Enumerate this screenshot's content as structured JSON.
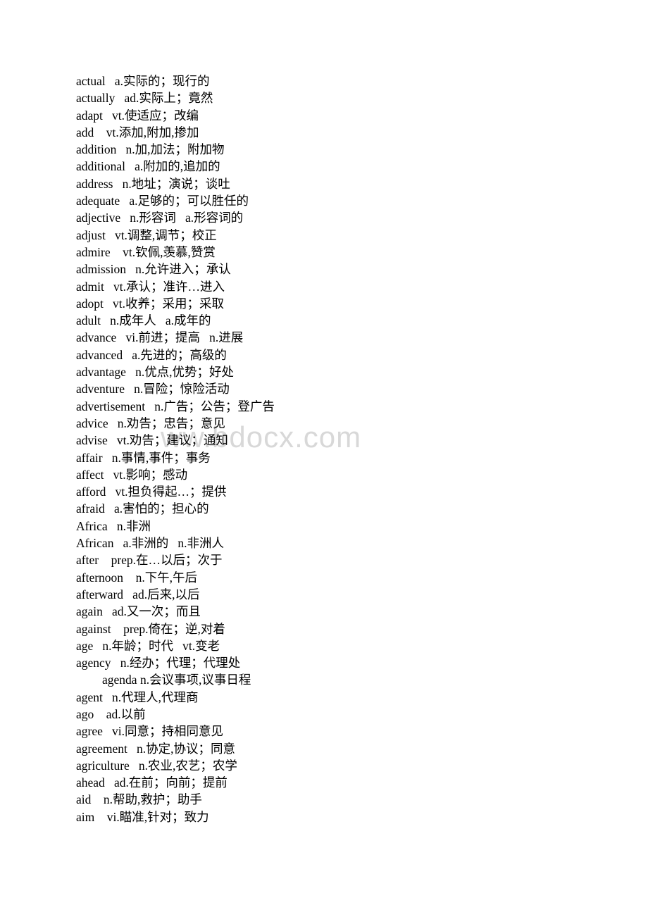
{
  "watermark": {
    "text": "ww.bdocx.com"
  },
  "document": {
    "entries": [
      {
        "word": "actual",
        "gap": "   ",
        "def": "a.实际的；现行的",
        "indent": false
      },
      {
        "word": "actually",
        "gap": "   ",
        "def": "ad.实际上；竟然",
        "indent": false
      },
      {
        "word": "adapt",
        "gap": "   ",
        "def": "vt.使适应；改编",
        "indent": false
      },
      {
        "word": "add",
        "gap": "    ",
        "def": "vt.添加,附加,掺加",
        "indent": false
      },
      {
        "word": "addition",
        "gap": "   ",
        "def": "n.加,加法；附加物",
        "indent": false
      },
      {
        "word": "additional",
        "gap": "   ",
        "def": "a.附加的,追加的",
        "indent": false
      },
      {
        "word": "address",
        "gap": "   ",
        "def": "n.地址；演说；谈吐",
        "indent": false
      },
      {
        "word": "adequate",
        "gap": "   ",
        "def": "a.足够的；可以胜任的",
        "indent": false
      },
      {
        "word": "adjective",
        "gap": "   ",
        "def": "n.形容词   a.形容词的",
        "indent": false
      },
      {
        "word": "adjust",
        "gap": "   ",
        "def": "vt.调整,调节；校正",
        "indent": false
      },
      {
        "word": "admire",
        "gap": "    ",
        "def": "vt.钦佩,羡慕,赞赏",
        "indent": false
      },
      {
        "word": "admission",
        "gap": "   ",
        "def": "n.允许进入；承认",
        "indent": false
      },
      {
        "word": "admit",
        "gap": "   ",
        "def": "vt.承认；准许…进入",
        "indent": false
      },
      {
        "word": "adopt",
        "gap": "   ",
        "def": "vt.收养；采用；采取",
        "indent": false
      },
      {
        "word": "adult",
        "gap": "   ",
        "def": "n.成年人   a.成年的",
        "indent": false
      },
      {
        "word": "advance",
        "gap": "   ",
        "def": "vi.前进；提高   n.进展",
        "indent": false
      },
      {
        "word": "advanced",
        "gap": "   ",
        "def": "a.先进的；高级的",
        "indent": false
      },
      {
        "word": "advantage",
        "gap": "   ",
        "def": "n.优点,优势；好处",
        "indent": false
      },
      {
        "word": "adventure",
        "gap": "   ",
        "def": "n.冒险；惊险活动",
        "indent": false
      },
      {
        "word": "advertisement",
        "gap": "   ",
        "def": "n.广告；公告；登广告",
        "indent": false
      },
      {
        "word": "advice",
        "gap": "   ",
        "def": "n.劝告；忠告；意见",
        "indent": false
      },
      {
        "word": "advise",
        "gap": "   ",
        "def": "vt.劝告；建议；通知",
        "indent": false
      },
      {
        "word": "affair",
        "gap": "   ",
        "def": "n.事情,事件；事务",
        "indent": false
      },
      {
        "word": "affect",
        "gap": "   ",
        "def": "vt.影响；感动",
        "indent": false
      },
      {
        "word": "afford",
        "gap": "   ",
        "def": "vt.担负得起…；提供",
        "indent": false
      },
      {
        "word": "afraid",
        "gap": "   ",
        "def": "a.害怕的；担心的",
        "indent": false
      },
      {
        "word": "Africa",
        "gap": "   ",
        "def": "n.非洲",
        "indent": false
      },
      {
        "word": "African",
        "gap": "   ",
        "def": "a.非洲的   n.非洲人",
        "indent": false
      },
      {
        "word": "after",
        "gap": "    ",
        "def": "prep.在…以后；次于",
        "indent": false
      },
      {
        "word": "afternoon",
        "gap": "    ",
        "def": "n.下午,午后",
        "indent": false
      },
      {
        "word": "afterward",
        "gap": "   ",
        "def": "ad.后来,以后",
        "indent": false
      },
      {
        "word": "again",
        "gap": "   ",
        "def": "ad.又一次；而且",
        "indent": false
      },
      {
        "word": "against",
        "gap": "    ",
        "def": "prep.倚在；逆,对着",
        "indent": false
      },
      {
        "word": "age",
        "gap": "   ",
        "def": "n.年龄；时代   vt.变老",
        "indent": false
      },
      {
        "word": "agency",
        "gap": "   ",
        "def": "n.经办；代理；代理处",
        "indent": false
      },
      {
        "word": "agenda",
        "gap": " ",
        "def": "n.会议事项,议事日程",
        "indent": true
      },
      {
        "word": "agent",
        "gap": "   ",
        "def": "n.代理人,代理商",
        "indent": false
      },
      {
        "word": "ago",
        "gap": "    ",
        "def": "ad.以前",
        "indent": false
      },
      {
        "word": "agree",
        "gap": "   ",
        "def": "vi.同意；持相同意见",
        "indent": false
      },
      {
        "word": "agreement",
        "gap": "   ",
        "def": "n.协定,协议；同意",
        "indent": false
      },
      {
        "word": "agriculture",
        "gap": "   ",
        "def": "n.农业,农艺；农学",
        "indent": false
      },
      {
        "word": "ahead",
        "gap": "   ",
        "def": "ad.在前；向前；提前",
        "indent": false
      },
      {
        "word": "aid",
        "gap": "    ",
        "def": "n.帮助,救护；助手",
        "indent": false
      },
      {
        "word": "aim",
        "gap": "    ",
        "def": "vi.瞄准,针对；致力",
        "indent": false
      }
    ]
  }
}
